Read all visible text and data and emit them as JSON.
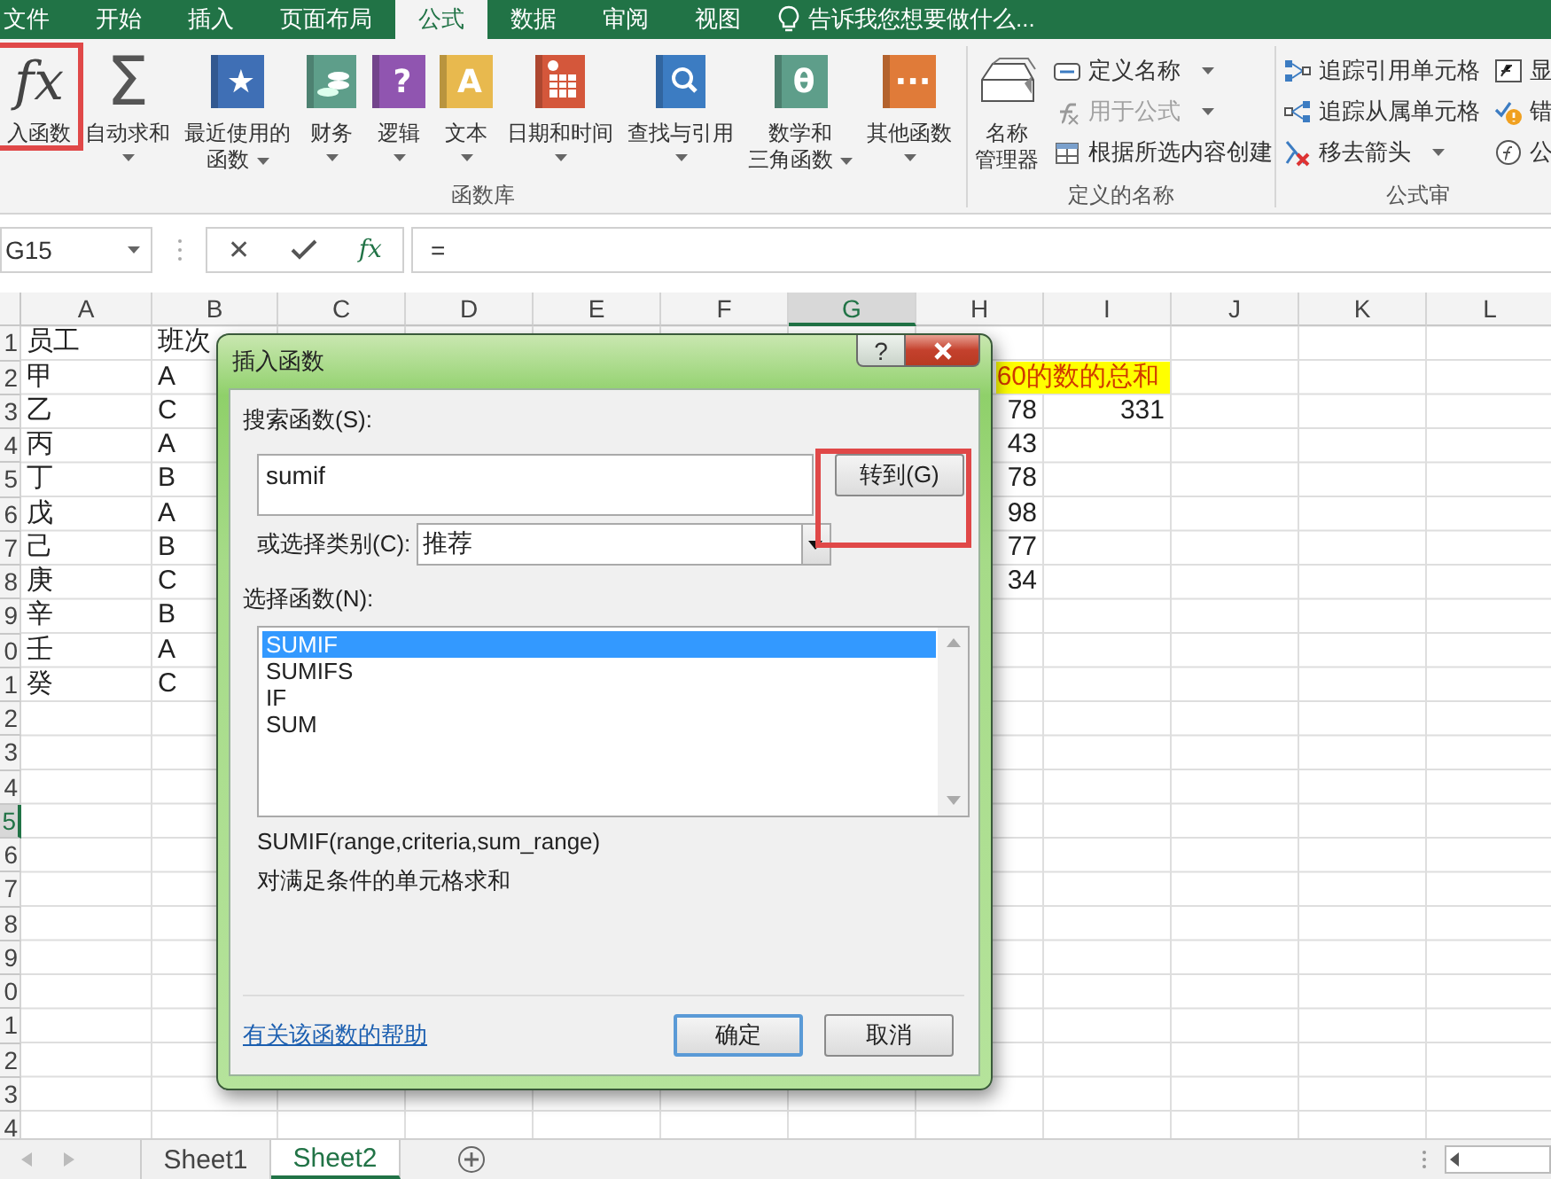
{
  "tabs": [
    {
      "label": "文件",
      "selected": false
    },
    {
      "label": "开始",
      "selected": false
    },
    {
      "label": "插入",
      "selected": false
    },
    {
      "label": "页面布局",
      "selected": false
    },
    {
      "label": "公式",
      "selected": true
    },
    {
      "label": "数据",
      "selected": false
    },
    {
      "label": "审阅",
      "selected": false
    },
    {
      "label": "视图",
      "selected": false
    }
  ],
  "tell_me": {
    "placeholder": "告诉我您想要做什么..."
  },
  "ribbon": {
    "groups": [
      {
        "label": "函数库",
        "large": [
          {
            "kind": "glyph",
            "glyph": "fx",
            "label_lines": [
              "入函数"
            ],
            "dropdown": false,
            "highlighted": true
          },
          {
            "kind": "glyph",
            "glyph": "Σ",
            "label_lines": [
              "自动求和"
            ],
            "dropdown": true,
            "highlighted": false
          },
          {
            "kind": "book",
            "glyph": "★",
            "color": "#3f6fb5",
            "label_lines": [
              "最近使用的",
              "函数"
            ],
            "dropdown": true,
            "highlighted": false
          },
          {
            "kind": "book-coins",
            "color": "#5e9e8a",
            "label_lines": [
              "财务"
            ],
            "dropdown": true,
            "highlighted": false
          },
          {
            "kind": "book",
            "glyph": "?",
            "color": "#9055b0",
            "label_lines": [
              "逻辑"
            ],
            "dropdown": true,
            "highlighted": false
          },
          {
            "kind": "book",
            "glyph": "A",
            "color": "#e8b94e",
            "label_lines": [
              "文本"
            ],
            "dropdown": true,
            "highlighted": false
          },
          {
            "kind": "book-calendar",
            "color": "#d4573b",
            "label_lines": [
              "日期和时间"
            ],
            "dropdown": true,
            "highlighted": false
          },
          {
            "kind": "book-search",
            "color": "#3c7cc2",
            "label_lines": [
              "查找与引用"
            ],
            "dropdown": true,
            "highlighted": false
          },
          {
            "kind": "book",
            "glyph": "θ",
            "color": "#5e9e8a",
            "label_lines": [
              "数学和",
              "三角函数"
            ],
            "dropdown": true,
            "highlighted": false
          },
          {
            "kind": "book",
            "glyph": "···",
            "color": "#e07b39",
            "label_lines": [
              "其他函数"
            ],
            "dropdown": true,
            "highlighted": false
          }
        ]
      },
      {
        "label": "定义的名称",
        "large": [
          {
            "kind": "name-manager",
            "label_lines": [
              "名称",
              "管理器"
            ],
            "dropdown": false,
            "highlighted": false
          }
        ],
        "small_columns": [
          [
            {
              "kind": "tag",
              "label": "定义名称",
              "dropdown": true,
              "disabled": false
            },
            {
              "kind": "use-formula",
              "label": "用于公式",
              "dropdown": true,
              "disabled": true
            },
            {
              "kind": "create-selection",
              "label": "根据所选内容创建",
              "dropdown": false,
              "disabled": false
            }
          ]
        ]
      },
      {
        "label": "公式审",
        "small_columns": [
          [
            {
              "kind": "trace-precedents",
              "label": "追踪引用单元格",
              "dropdown": false,
              "disabled": false
            },
            {
              "kind": "trace-dependents",
              "label": "追踪从属单元格",
              "dropdown": false,
              "disabled": false
            },
            {
              "kind": "remove-arrows",
              "label": "移去箭头",
              "dropdown": true,
              "disabled": false
            }
          ],
          [
            {
              "kind": "show-formulas",
              "label": "显",
              "dropdown": false,
              "disabled": false
            },
            {
              "kind": "error-check",
              "label": "错",
              "dropdown": false,
              "disabled": false
            },
            {
              "kind": "evaluate",
              "label": "公",
              "dropdown": false,
              "disabled": false
            }
          ]
        ]
      }
    ]
  },
  "formula_bar": {
    "name_box": "G15",
    "cancel_glyph": "✕",
    "fx_glyph": "fx",
    "formula": "="
  },
  "sheet": {
    "columns": [
      {
        "label": "A",
        "selected": false
      },
      {
        "label": "B",
        "selected": false
      },
      {
        "label": "C",
        "selected": false
      },
      {
        "label": "D",
        "selected": false
      },
      {
        "label": "E",
        "selected": false
      },
      {
        "label": "F",
        "selected": false
      },
      {
        "label": "G",
        "selected": true
      },
      {
        "label": "H",
        "selected": false
      },
      {
        "label": "I",
        "selected": false
      },
      {
        "label": "J",
        "selected": false
      },
      {
        "label": "K",
        "selected": false
      },
      {
        "label": "L",
        "selected": false
      }
    ],
    "rows": [
      {
        "header": "1",
        "selected": false,
        "cells": [
          {
            "text": "员工",
            "kind": "text"
          },
          {
            "text": "班次",
            "kind": "text"
          }
        ]
      },
      {
        "header": "2",
        "selected": false,
        "cells": [
          {
            "text": "甲",
            "kind": "text"
          },
          {
            "text": "A",
            "kind": "text"
          },
          {
            "kind": "blank"
          },
          {
            "kind": "blank"
          },
          {
            "kind": "blank"
          },
          {
            "kind": "blank"
          },
          {
            "kind": "blank"
          },
          {
            "text": "60的数的总和",
            "kind": "text",
            "highlight": true
          }
        ]
      },
      {
        "header": "3",
        "selected": false,
        "cells": [
          {
            "text": "乙",
            "kind": "text"
          },
          {
            "text": "C",
            "kind": "text"
          },
          {
            "kind": "blank"
          },
          {
            "kind": "blank"
          },
          {
            "kind": "blank"
          },
          {
            "kind": "blank"
          },
          {
            "kind": "blank"
          },
          {
            "text": "78",
            "kind": "number"
          },
          {
            "text": "331",
            "kind": "number"
          }
        ]
      },
      {
        "header": "4",
        "selected": false,
        "cells": [
          {
            "text": "丙",
            "kind": "text"
          },
          {
            "text": "A",
            "kind": "text"
          },
          {
            "kind": "blank"
          },
          {
            "kind": "blank"
          },
          {
            "kind": "blank"
          },
          {
            "kind": "blank"
          },
          {
            "kind": "blank"
          },
          {
            "text": "43",
            "kind": "number"
          }
        ]
      },
      {
        "header": "5",
        "selected": false,
        "cells": [
          {
            "text": "丁",
            "kind": "text"
          },
          {
            "text": "B",
            "kind": "text"
          },
          {
            "kind": "blank"
          },
          {
            "kind": "blank"
          },
          {
            "kind": "blank"
          },
          {
            "kind": "blank"
          },
          {
            "kind": "blank"
          },
          {
            "text": "78",
            "kind": "number"
          }
        ]
      },
      {
        "header": "6",
        "selected": false,
        "cells": [
          {
            "text": "戊",
            "kind": "text"
          },
          {
            "text": "A",
            "kind": "text"
          },
          {
            "kind": "blank"
          },
          {
            "kind": "blank"
          },
          {
            "kind": "blank"
          },
          {
            "kind": "blank"
          },
          {
            "kind": "blank"
          },
          {
            "text": "98",
            "kind": "number"
          }
        ]
      },
      {
        "header": "7",
        "selected": false,
        "cells": [
          {
            "text": "己",
            "kind": "text"
          },
          {
            "text": "B",
            "kind": "text"
          },
          {
            "kind": "blank"
          },
          {
            "kind": "blank"
          },
          {
            "kind": "blank"
          },
          {
            "kind": "blank"
          },
          {
            "kind": "blank"
          },
          {
            "text": "77",
            "kind": "number"
          }
        ]
      },
      {
        "header": "8",
        "selected": false,
        "cells": [
          {
            "text": "庚",
            "kind": "text"
          },
          {
            "text": "C",
            "kind": "text"
          },
          {
            "kind": "blank"
          },
          {
            "kind": "blank"
          },
          {
            "kind": "blank"
          },
          {
            "kind": "blank"
          },
          {
            "kind": "blank"
          },
          {
            "text": "34",
            "kind": "number"
          }
        ]
      },
      {
        "header": "9",
        "selected": false,
        "cells": [
          {
            "text": "辛",
            "kind": "text"
          },
          {
            "text": "B",
            "kind": "text"
          }
        ]
      },
      {
        "header": "0",
        "selected": false,
        "cells": [
          {
            "text": "壬",
            "kind": "text"
          },
          {
            "text": "A",
            "kind": "text"
          }
        ]
      },
      {
        "header": "1",
        "selected": false,
        "cells": [
          {
            "text": "癸",
            "kind": "text"
          },
          {
            "text": "C",
            "kind": "text"
          }
        ]
      },
      {
        "header": "2",
        "selected": false
      },
      {
        "header": "3",
        "selected": false
      },
      {
        "header": "4",
        "selected": false
      },
      {
        "header": "5",
        "selected": true
      },
      {
        "header": "6",
        "selected": false
      },
      {
        "header": "7",
        "selected": false
      },
      {
        "header": "8",
        "selected": false
      },
      {
        "header": "9",
        "selected": false
      },
      {
        "header": "0",
        "selected": false
      },
      {
        "header": "1",
        "selected": false
      },
      {
        "header": "2",
        "selected": false
      },
      {
        "header": "3",
        "selected": false
      },
      {
        "header": "4",
        "selected": false
      }
    ]
  },
  "dialog": {
    "title": "插入函数",
    "help_glyph": "?",
    "search_label": "搜索函数(S):",
    "search_value": "sumif",
    "go_button": {
      "label": "转到(G)",
      "highlighted": true
    },
    "category_label": "或选择类别(C):",
    "category_value": "推荐",
    "list_label": "选择函数(N):",
    "functions": [
      {
        "name": "SUMIF",
        "selected": true
      },
      {
        "name": "SUMIFS",
        "selected": false
      },
      {
        "name": "IF",
        "selected": false
      },
      {
        "name": "SUM",
        "selected": false
      }
    ],
    "signature": "SUMIF(range,criteria,sum_range)",
    "description": "对满足条件的单元格求和",
    "help_link": "有关该函数的帮助",
    "ok_button": {
      "label": "确定",
      "default": true
    },
    "cancel_button": {
      "label": "取消"
    }
  },
  "sheet_tabs": [
    {
      "label": "Sheet1",
      "selected": false
    },
    {
      "label": "Sheet2",
      "selected": true
    }
  ]
}
